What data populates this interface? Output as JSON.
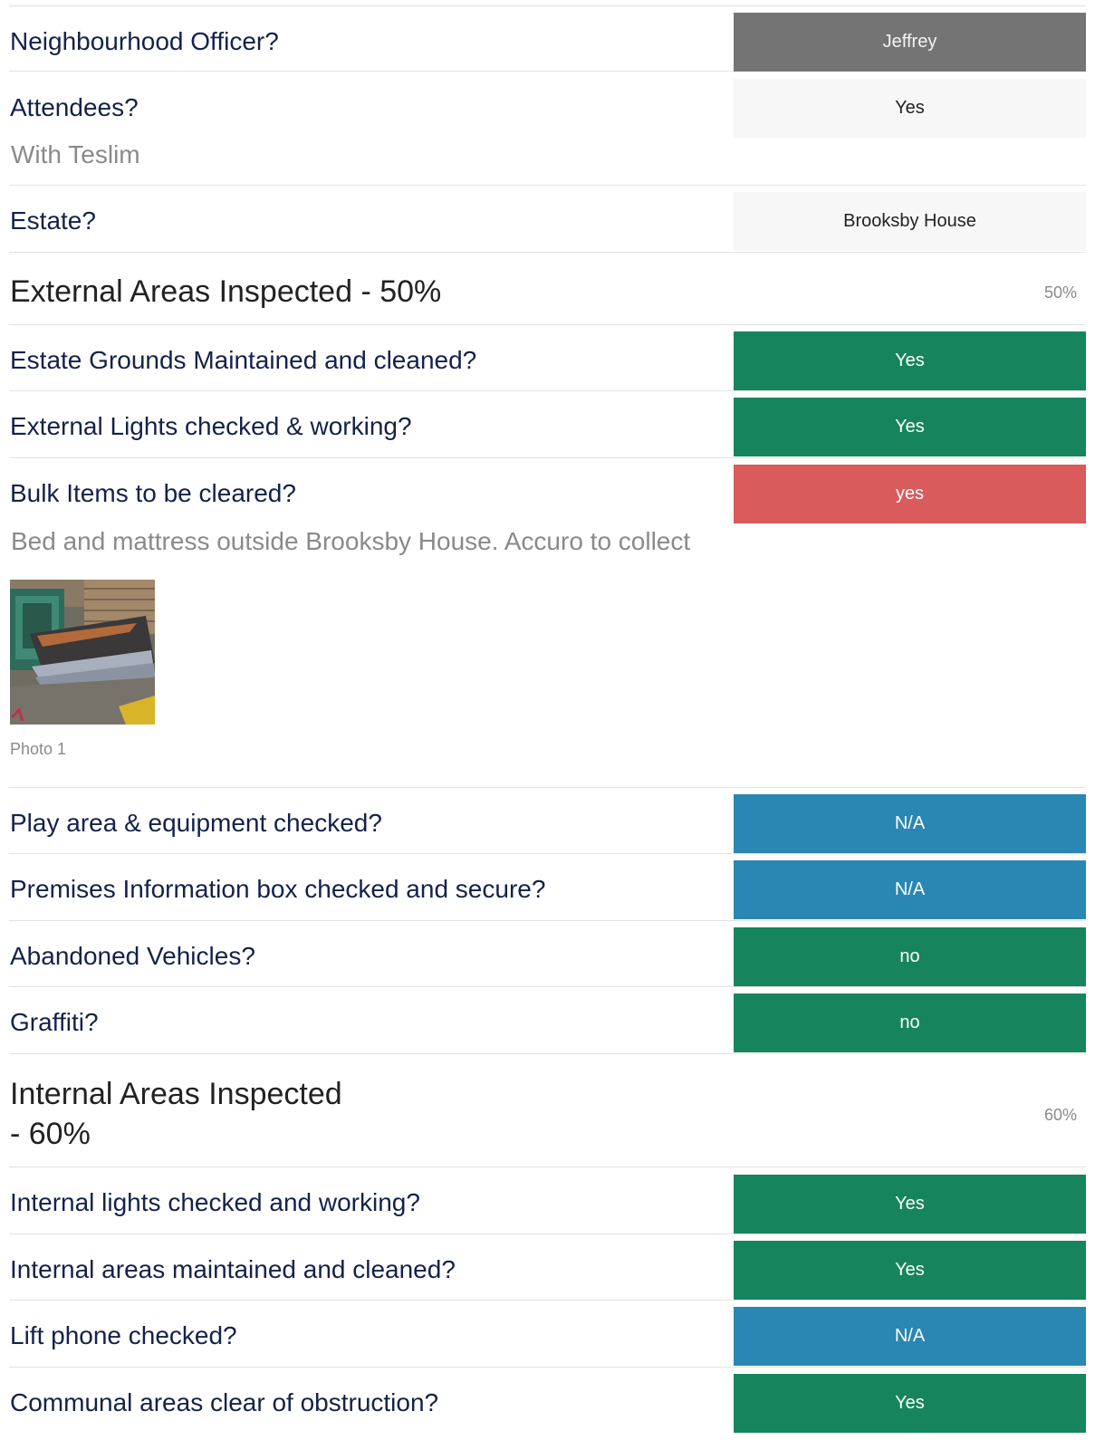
{
  "rows": {
    "officer": {
      "question": "Neighbourhood Officer?",
      "answer": "Jeffrey"
    },
    "attendees": {
      "question": "Attendees?",
      "answer": "Yes",
      "note": "With Teslim"
    },
    "estate": {
      "question": "Estate?",
      "answer": "Brooksby House"
    },
    "external_section": {
      "title": "External Areas Inspected - 50%",
      "score": "50%"
    },
    "grounds": {
      "question": "Estate Grounds Maintained and cleaned?",
      "answer": "Yes"
    },
    "ext_lights": {
      "question": "External Lights checked & working?",
      "answer": "Yes"
    },
    "bulk": {
      "question": "Bulk Items to be cleared?",
      "answer": "yes",
      "note": "Bed and mattress outside Brooksby House. Accuro to collect",
      "photo_caption": "Photo 1"
    },
    "play_area": {
      "question": "Play area & equipment checked?",
      "answer": "N/A"
    },
    "premises_box": {
      "question": "Premises Information box checked and secure?",
      "answer": "N/A"
    },
    "vehicles": {
      "question": "Abandoned Vehicles?",
      "answer": "no"
    },
    "graffiti": {
      "question": "Graffiti?",
      "answer": "no"
    },
    "internal_section": {
      "title": "Internal Areas Inspected\n - 60%",
      "score": "60%"
    },
    "int_lights": {
      "question": "Internal lights checked and working?",
      "answer": "Yes"
    },
    "int_clean": {
      "question": "Internal areas maintained and cleaned?",
      "answer": "Yes"
    },
    "lift_phone": {
      "question": "Lift phone checked?",
      "answer": "N/A"
    },
    "communal": {
      "question": "Communal areas clear of obstruction?",
      "answer": "Yes"
    }
  },
  "colors": {
    "question_text": "#14224a",
    "yes_green": "#16855d",
    "flag_red": "#d95b5c",
    "na_blue": "#2a86b2",
    "officer_grey": "#747474",
    "neutral_light": "#f7f7f7"
  }
}
